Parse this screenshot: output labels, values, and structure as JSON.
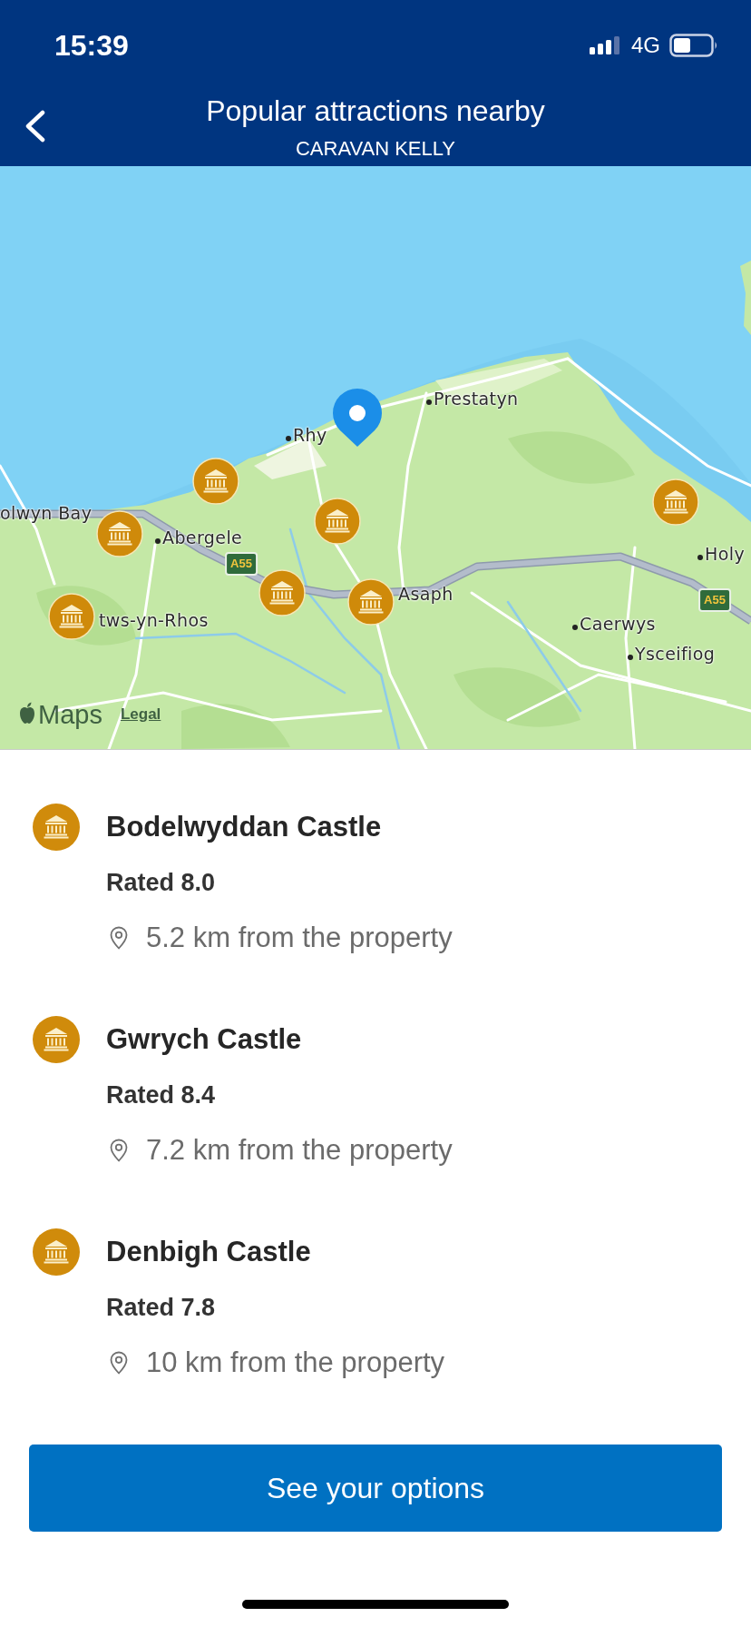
{
  "status_bar": {
    "time": "15:39",
    "network": "4G"
  },
  "header": {
    "title": "Popular attractions nearby",
    "subtitle": "CARAVAN KELLY"
  },
  "map": {
    "labels": [
      {
        "kind": "town",
        "text": "Prestatyn"
      },
      {
        "kind": "town",
        "text": "Rhy"
      },
      {
        "kind": "area",
        "text": "olwyn Bay"
      },
      {
        "kind": "town",
        "text": "Abergele"
      },
      {
        "kind": "area",
        "text": "tws-yn-Rhos"
      },
      {
        "kind": "area",
        "text": "Asaph"
      },
      {
        "kind": "town",
        "text": "Caerwys"
      },
      {
        "kind": "town",
        "text": "Ysceifiog"
      },
      {
        "kind": "town",
        "text": "Holy"
      },
      {
        "kind": "road",
        "text": "A55"
      },
      {
        "kind": "road",
        "text": "A55"
      }
    ],
    "markers": [
      {
        "kind": "property"
      },
      {
        "kind": "attraction"
      },
      {
        "kind": "attraction"
      },
      {
        "kind": "attraction"
      },
      {
        "kind": "attraction"
      },
      {
        "kind": "attraction"
      },
      {
        "kind": "attraction"
      },
      {
        "kind": "attraction"
      }
    ],
    "logo": "Maps",
    "legal_link": "Legal"
  },
  "attractions": [
    {
      "name": "Bodelwyddan Castle",
      "rating": "Rated 8.0",
      "distance": "5.2 km from the property"
    },
    {
      "name": "Gwrych Castle",
      "rating": "Rated 8.4",
      "distance": "7.2 km from the property"
    },
    {
      "name": "Denbigh Castle",
      "rating": "Rated 7.8",
      "distance": "10 km from the property"
    }
  ],
  "button": "See your options"
}
